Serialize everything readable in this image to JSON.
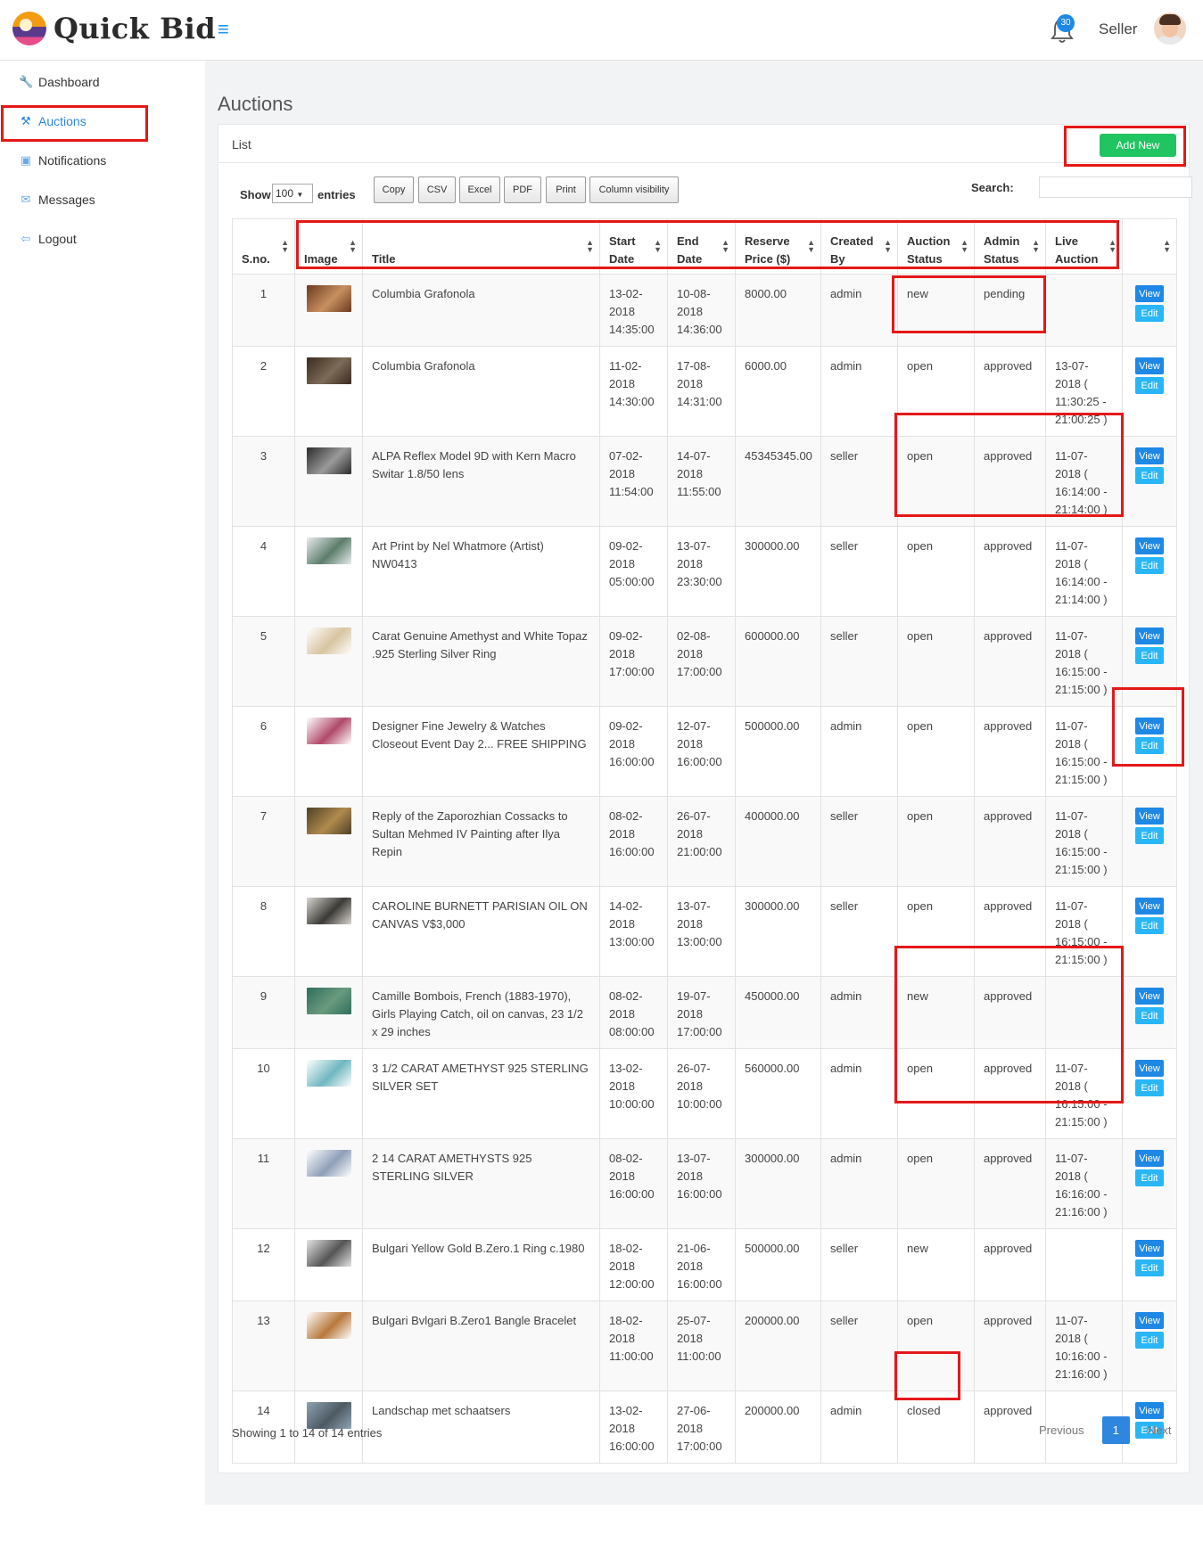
{
  "app": {
    "name": "Quick Bid"
  },
  "header": {
    "notification_count": "30",
    "user_label": "Seller"
  },
  "sidebar": {
    "items": [
      {
        "label": "Dashboard",
        "icon": "wrench-icon"
      },
      {
        "label": "Auctions",
        "icon": "gavel-icon"
      },
      {
        "label": "Notifications",
        "icon": "briefcase-icon"
      },
      {
        "label": "Messages",
        "icon": "envelope-icon"
      },
      {
        "label": "Logout",
        "icon": "arrow-left-icon"
      }
    ]
  },
  "page": {
    "title": "Auctions"
  },
  "card": {
    "title": "List",
    "add_label": "Add New"
  },
  "controls": {
    "show_label": "Show",
    "entries_value": "100",
    "entries_label": "entries",
    "buttons": [
      "Copy",
      "CSV",
      "Excel",
      "PDF",
      "Print",
      "Column visibility"
    ],
    "search_label": "Search:",
    "search_value": ""
  },
  "table": {
    "headers": [
      [
        "S.no."
      ],
      [
        "Image"
      ],
      [
        "Title"
      ],
      [
        "Start",
        "Date"
      ],
      [
        "End",
        "Date"
      ],
      [
        "Reserve",
        "Price ($)"
      ],
      [
        "Created",
        "By"
      ],
      [
        "Auction",
        "Status"
      ],
      [
        "Admin",
        "Status"
      ],
      [
        "Live",
        "Auction"
      ],
      [
        ""
      ]
    ],
    "view_label": "View",
    "edit_label": "Edit",
    "rows": [
      {
        "sno": "1",
        "title": "Columbia Grafonola",
        "start": [
          "13-02-",
          "2018",
          "14:35:00"
        ],
        "end": [
          "10-08-",
          "2018",
          "14:36:00"
        ],
        "price": "8000.00",
        "by": "admin",
        "astatus": "new",
        "adstatus": "pending",
        "live": [],
        "thumb": [
          "#6b3a1f",
          "#c89060"
        ]
      },
      {
        "sno": "2",
        "title": "Columbia Grafonola",
        "start": [
          "11-02-",
          "2018",
          "14:30:00"
        ],
        "end": [
          "17-08-",
          "2018",
          "14:31:00"
        ],
        "price": "6000.00",
        "by": "admin",
        "astatus": "open",
        "adstatus": "approved",
        "live": [
          "13-07-",
          "2018 (",
          "11:30:25 -",
          "21:00:25 )"
        ],
        "thumb": [
          "#3a2a1e",
          "#7c6b57"
        ]
      },
      {
        "sno": "3",
        "title": "ALPA Reflex Model 9D with Kern Macro Switar 1.8/50 lens",
        "start": [
          "07-02-",
          "2018",
          "11:54:00"
        ],
        "end": [
          "14-07-",
          "2018",
          "11:55:00"
        ],
        "price": "45345345.00",
        "by": "seller",
        "astatus": "open",
        "adstatus": "approved",
        "live": [
          "11-07-",
          "2018 (",
          "16:14:00 -",
          "21:14:00 )"
        ],
        "thumb": [
          "#2b2b2b",
          "#9a9a9a"
        ]
      },
      {
        "sno": "4",
        "title": "Art Print by Nel Whatmore (Artist) NW0413",
        "start": [
          "09-02-",
          "2018",
          "05:00:00"
        ],
        "end": [
          "13-07-",
          "2018",
          "23:30:00"
        ],
        "price": "300000.00",
        "by": "seller",
        "astatus": "open",
        "adstatus": "approved",
        "live": [
          "11-07-",
          "2018 (",
          "16:14:00 -",
          "21:14:00 )"
        ],
        "thumb": [
          "#e8ecef",
          "#5d7d6a"
        ]
      },
      {
        "sno": "5",
        "title": "Carat Genuine Amethyst and White Topaz .925 Sterling Silver Ring",
        "start": [
          "09-02-",
          "2018",
          "17:00:00"
        ],
        "end": [
          "02-08-",
          "2018",
          "17:00:00"
        ],
        "price": "600000.00",
        "by": "seller",
        "astatus": "open",
        "adstatus": "approved",
        "live": [
          "11-07-",
          "2018 (",
          "16:15:00 -",
          "21:15:00 )"
        ],
        "thumb": [
          "#ffffff",
          "#d8c4a0"
        ]
      },
      {
        "sno": "6",
        "title": "Designer Fine Jewelry & Watches Closeout Event Day 2... FREE SHIPPING",
        "start": [
          "09-02-",
          "2018",
          "16:00:00"
        ],
        "end": [
          "12-07-",
          "2018",
          "16:00:00"
        ],
        "price": "500000.00",
        "by": "admin",
        "astatus": "open",
        "adstatus": "approved",
        "live": [
          "11-07-",
          "2018 (",
          "16:15:00 -",
          "21:15:00 )"
        ],
        "thumb": [
          "#ffffff",
          "#b04a6a"
        ]
      },
      {
        "sno": "7",
        "title": "Reply of the Zaporozhian Cossacks to Sultan Mehmed IV Painting after Ilya Repin",
        "start": [
          "08-02-",
          "2018",
          "16:00:00"
        ],
        "end": [
          "26-07-",
          "2018",
          "21:00:00"
        ],
        "price": "400000.00",
        "by": "seller",
        "astatus": "open",
        "adstatus": "approved",
        "live": [
          "11-07-",
          "2018 (",
          "16:15:00 -",
          "21:15:00 )"
        ],
        "thumb": [
          "#4e4024",
          "#b08a4e"
        ]
      },
      {
        "sno": "8",
        "title": "CAROLINE BURNETT PARISIAN OIL ON CANVAS V$3,000",
        "start": [
          "14-02-",
          "2018",
          "13:00:00"
        ],
        "end": [
          "13-07-",
          "2018",
          "13:00:00"
        ],
        "price": "300000.00",
        "by": "seller",
        "astatus": "open",
        "adstatus": "approved",
        "live": [
          "11-07-",
          "2018 (",
          "16:15:00 -",
          "21:15:00 )"
        ],
        "thumb": [
          "#d9d6d0",
          "#3c3a36"
        ]
      },
      {
        "sno": "9",
        "title": "Camille Bombois, French (1883-1970), Girls Playing Catch, oil on canvas, 23 1/2 x 29 inches",
        "start": [
          "08-02-",
          "2018",
          "08:00:00"
        ],
        "end": [
          "19-07-",
          "2018",
          "17:00:00"
        ],
        "price": "450000.00",
        "by": "admin",
        "astatus": "new",
        "adstatus": "approved",
        "live": [],
        "thumb": [
          "#2e6e5c",
          "#6a9a7e"
        ]
      },
      {
        "sno": "10",
        "title": "3 1/2 CARAT AMETHYST 925 STERLING SILVER SET",
        "start": [
          "13-02-",
          "2018",
          "10:00:00"
        ],
        "end": [
          "26-07-",
          "2018",
          "10:00:00"
        ],
        "price": "560000.00",
        "by": "admin",
        "astatus": "open",
        "adstatus": "approved",
        "live": [
          "11-07-",
          "2018 (",
          "16:15:00 -",
          "21:15:00 )"
        ],
        "thumb": [
          "#ffffff",
          "#6fb7c0"
        ]
      },
      {
        "sno": "11",
        "title": "2 14 CARAT AMETHYSTS 925 STERLING SILVER",
        "start": [
          "08-02-",
          "2018",
          "16:00:00"
        ],
        "end": [
          "13-07-",
          "2018",
          "16:00:00"
        ],
        "price": "300000.00",
        "by": "admin",
        "astatus": "open",
        "adstatus": "approved",
        "live": [
          "11-07-",
          "2018 (",
          "16:16:00 -",
          "21:16:00 )"
        ],
        "thumb": [
          "#ffffff",
          "#8f9fb8"
        ]
      },
      {
        "sno": "12",
        "title": "Bulgari Yellow Gold B.Zero.1 Ring c.1980",
        "start": [
          "18-02-",
          "2018",
          "12:00:00"
        ],
        "end": [
          "21-06-",
          "2018",
          "16:00:00"
        ],
        "price": "500000.00",
        "by": "seller",
        "astatus": "new",
        "adstatus": "approved",
        "live": [],
        "thumb": [
          "#e4e4e4",
          "#555555"
        ]
      },
      {
        "sno": "13",
        "title": "Bulgari Bvlgari B.Zero1 Bangle Bracelet",
        "start": [
          "18-02-",
          "2018",
          "11:00:00"
        ],
        "end": [
          "25-07-",
          "2018",
          "11:00:00"
        ],
        "price": "200000.00",
        "by": "seller",
        "astatus": "open",
        "adstatus": "approved",
        "live": [
          "11-07-",
          "2018 (",
          "10:16:00 -",
          "21:16:00 )"
        ],
        "thumb": [
          "#ffffff",
          "#b8783c"
        ]
      },
      {
        "sno": "14",
        "title": "Landschap met schaatsers",
        "start": [
          "13-02-",
          "2018",
          "16:00:00"
        ],
        "end": [
          "27-06-",
          "2018",
          "17:00:00"
        ],
        "price": "200000.00",
        "by": "admin",
        "astatus": "closed",
        "adstatus": "approved",
        "live": [],
        "thumb": [
          "#8fa3b3",
          "#4d5a63"
        ]
      }
    ]
  },
  "footer": {
    "info": "Showing 1 to 14 of 14 entries",
    "prev": "Previous",
    "page": "1",
    "next": "Next"
  },
  "colors": {
    "accent": "#2e86de",
    "add_button": "#20c461",
    "view_button": "#1e88e5",
    "edit_button": "#29b6f6",
    "highlight": "#e51818"
  }
}
